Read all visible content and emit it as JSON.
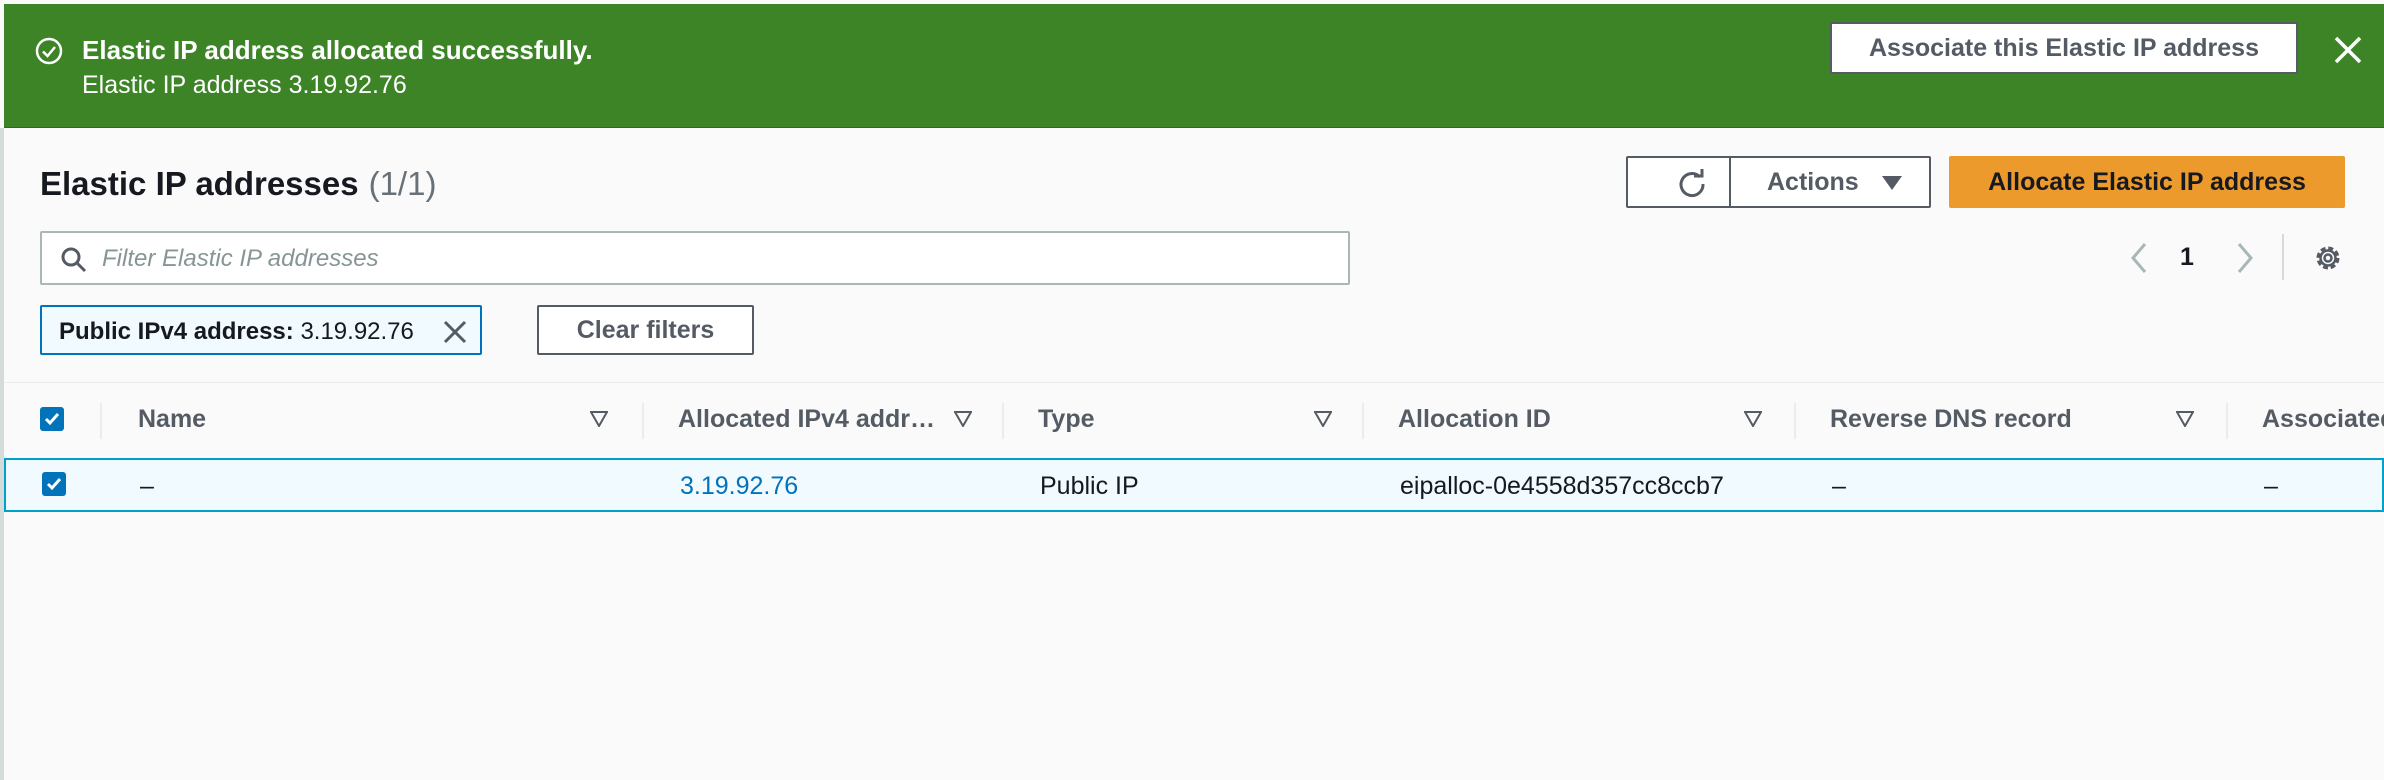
{
  "flash": {
    "title": "Elastic IP address allocated successfully.",
    "message": "Elastic IP address 3.19.92.76",
    "associate_label": "Associate this Elastic IP address",
    "icon": "check-circle-icon",
    "close_icon": "close-icon"
  },
  "header": {
    "title": "Elastic IP addresses",
    "count": "(1/1)",
    "refresh_icon": "refresh-icon",
    "actions_label": "Actions",
    "allocate_label": "Allocate Elastic IP address"
  },
  "filter": {
    "placeholder": "Filter Elastic IP addresses",
    "value": "",
    "token_key": "Public IPv4 address:",
    "token_value": "3.19.92.76",
    "clear_label": "Clear filters"
  },
  "pagination": {
    "current_page": "1"
  },
  "table": {
    "columns": [
      {
        "label": "Name"
      },
      {
        "label": "Allocated IPv4 addr…"
      },
      {
        "label": "Type"
      },
      {
        "label": "Allocation ID"
      },
      {
        "label": "Reverse DNS record"
      },
      {
        "label": "Associated"
      }
    ],
    "rows": [
      {
        "selected": true,
        "name": "–",
        "ipv4": "3.19.92.76",
        "type": "Public IP",
        "allocation_id": "eipalloc-0e4558d357cc8ccb7",
        "reverse_dns": "–",
        "associated": "–"
      }
    ]
  },
  "colors": {
    "success": "#3c8426",
    "primary": "#ec9a2c",
    "link": "#0073bb",
    "selected_row": "#f1faff"
  }
}
